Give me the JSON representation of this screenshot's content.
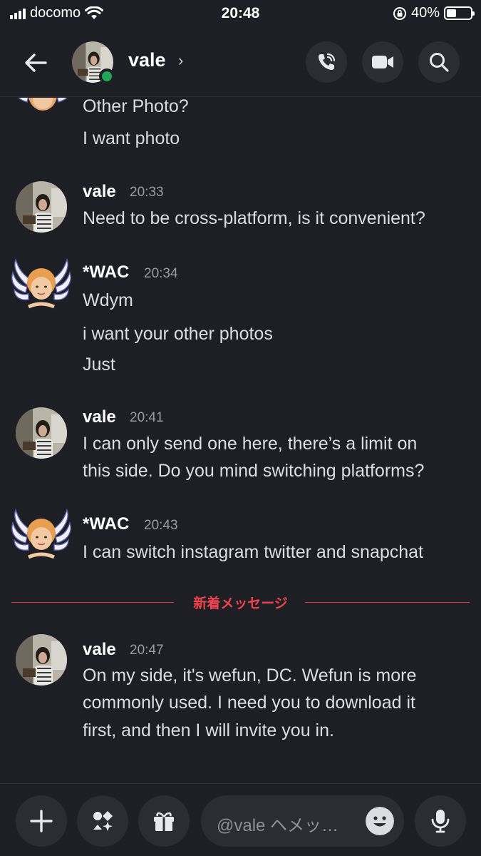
{
  "status": {
    "carrier": "docomo",
    "time": "20:48",
    "battery": "40%",
    "battery_level": 0.4
  },
  "header": {
    "name": "vale",
    "chevron": "›",
    "icons": [
      "back-arrow-icon",
      "phone-call-icon",
      "video-camera-icon",
      "search-icon"
    ],
    "online_color": "#23a55a"
  },
  "messages": [
    {
      "lines": [
        "Other Photo?"
      ]
    },
    {
      "lines": [
        "I want photo"
      ]
    },
    {
      "author": "vale",
      "time": "20:33",
      "lines": [
        "Need to be cross-platform, is it convenient?"
      ]
    },
    {
      "author": "*WAC",
      "time": "20:34",
      "lines": [
        "Wdym"
      ]
    },
    {
      "lines": [
        "i want your other photos"
      ]
    },
    {
      "lines": [
        "Just"
      ]
    },
    {
      "author": "vale",
      "time": "20:41",
      "lines": [
        "I can only send one here, there’s a limit on",
        "this side. Do you mind switching platforms?"
      ]
    },
    {
      "author": "*WAC",
      "time": "20:43",
      "lines": [
        "I can switch instagram twitter and snapchat"
      ]
    },
    {
      "author": "vale",
      "time": "20:47",
      "lines": [
        "On my side, it's wefun, DC. Wefun is more",
        "commonly used. I need you to download it",
        "first, and then I will invite you in."
      ]
    }
  ],
  "divider": {
    "label": "新着メッセージ",
    "color": "#f0434d"
  },
  "composer": {
    "placeholder": "@vale ヘメッ…",
    "icons": [
      "plus-icon",
      "apps-icon",
      "gift-icon",
      "emoji-icon",
      "microphone-icon"
    ]
  }
}
